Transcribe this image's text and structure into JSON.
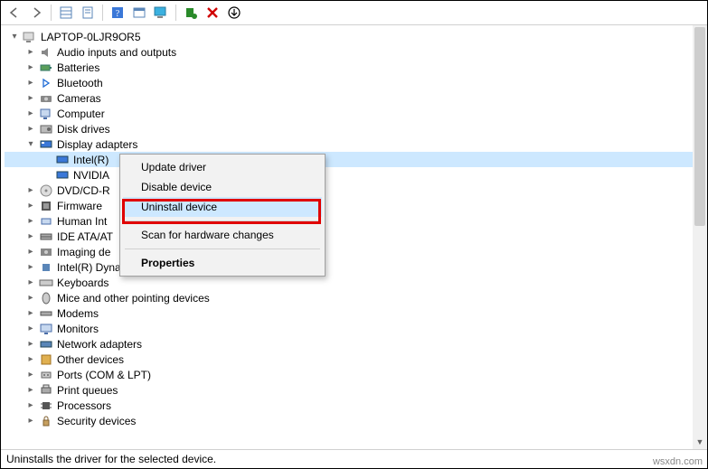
{
  "tree": {
    "root": "LAPTOP-0LJR9OR5",
    "categories": [
      {
        "name": "Audio inputs and outputs"
      },
      {
        "name": "Batteries"
      },
      {
        "name": "Bluetooth"
      },
      {
        "name": "Cameras"
      },
      {
        "name": "Computer"
      },
      {
        "name": "Disk drives"
      },
      {
        "name": "Display adapters",
        "expanded": true,
        "children": [
          "Intel(R)",
          "NVIDIA"
        ]
      },
      {
        "name": "DVD/CD-R"
      },
      {
        "name": "Firmware"
      },
      {
        "name": "Human Int"
      },
      {
        "name": "IDE ATA/AT"
      },
      {
        "name": "Imaging de"
      },
      {
        "name": "Intel(R) Dynamic Platform and Thermal Framework"
      },
      {
        "name": "Keyboards"
      },
      {
        "name": "Mice and other pointing devices"
      },
      {
        "name": "Modems"
      },
      {
        "name": "Monitors"
      },
      {
        "name": "Network adapters"
      },
      {
        "name": "Other devices"
      },
      {
        "name": "Ports (COM & LPT)"
      },
      {
        "name": "Print queues"
      },
      {
        "name": "Processors"
      },
      {
        "name": "Security devices"
      }
    ]
  },
  "context_menu": {
    "items": [
      "Update driver",
      "Disable device",
      "Uninstall device",
      "Scan for hardware changes",
      "Properties"
    ],
    "highlighted_index": 2
  },
  "statusbar": {
    "text": "Uninstalls the driver for the selected device."
  },
  "watermark": "wsxdn.com",
  "colors": {
    "selection": "#cde8ff",
    "highlight_border": "#e00000"
  }
}
